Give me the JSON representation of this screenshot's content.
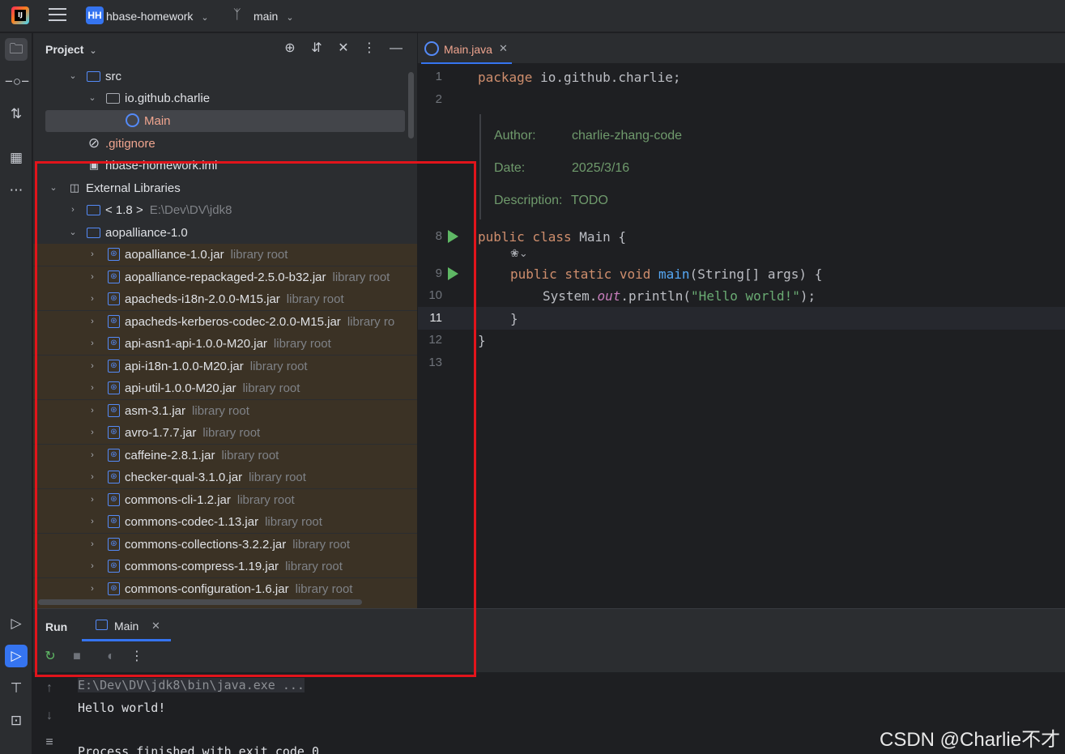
{
  "titlebar": {
    "project_badge": "HH",
    "project_name": "hbase-homework",
    "branch": "main"
  },
  "left_strip": {
    "icons": [
      "folder-icon",
      "commit-icon",
      "pull-requests-icon",
      "structure-icon",
      "more-icon",
      "services-icon",
      "run-icon",
      "build-icon",
      "terminal-icon"
    ]
  },
  "project_panel": {
    "title": "Project",
    "tree": [
      {
        "label": "src",
        "sub": ""
      },
      {
        "label": "io.github.charlie",
        "sub": ""
      },
      {
        "label": "Main",
        "sub": ""
      },
      {
        "label": ".gitignore",
        "sub": ""
      },
      {
        "label": "hbase-homework.iml",
        "sub": ""
      },
      {
        "label": "External Libraries",
        "sub": ""
      },
      {
        "label": "< 1.8 >",
        "sub": "E:\\Dev\\DV\\jdk8"
      },
      {
        "label": "aopalliance-1.0",
        "sub": ""
      },
      {
        "label": "aopalliance-1.0.jar",
        "sub": "library root"
      },
      {
        "label": "aopalliance-repackaged-2.5.0-b32.jar",
        "sub": "library root"
      },
      {
        "label": "apacheds-i18n-2.0.0-M15.jar",
        "sub": "library root"
      },
      {
        "label": "apacheds-kerberos-codec-2.0.0-M15.jar",
        "sub": "library ro"
      },
      {
        "label": "api-asn1-api-1.0.0-M20.jar",
        "sub": "library root"
      },
      {
        "label": "api-i18n-1.0.0-M20.jar",
        "sub": "library root"
      },
      {
        "label": "api-util-1.0.0-M20.jar",
        "sub": "library root"
      },
      {
        "label": "asm-3.1.jar",
        "sub": "library root"
      },
      {
        "label": "avro-1.7.7.jar",
        "sub": "library root"
      },
      {
        "label": "caffeine-2.8.1.jar",
        "sub": "library root"
      },
      {
        "label": "checker-qual-3.1.0.jar",
        "sub": "library root"
      },
      {
        "label": "commons-cli-1.2.jar",
        "sub": "library root"
      },
      {
        "label": "commons-codec-1.13.jar",
        "sub": "library root"
      },
      {
        "label": "commons-collections-3.2.2.jar",
        "sub": "library root"
      },
      {
        "label": "commons-compress-1.19.jar",
        "sub": "library root"
      },
      {
        "label": "commons-configuration-1.6.jar",
        "sub": "library root"
      }
    ]
  },
  "editor": {
    "tab_label": "Main.java",
    "line_numbers": [
      "1",
      "2",
      "8",
      "9",
      "10",
      "11",
      "12",
      "13"
    ],
    "code": {
      "l1_kw": "package",
      "l1_rest": " io.github.charlie;",
      "l8_kw": "public class",
      "l8_rest": " Main {",
      "l9_kw": "public static void",
      "l9_fn": "main",
      "l9_rest": "(String[] args) {",
      "l10_a": "System.",
      "l10_b": "out",
      "l10_c": ".println(",
      "l10_d": "\"Hello world!\"",
      "l10_e": ");",
      "l11": "}",
      "l12": "}"
    },
    "doc": {
      "author_label": "Author:",
      "author_value": "charlie-zhang-code",
      "date_label": "Date:",
      "date_value": "2025/3/16",
      "desc_label": "Description:",
      "desc_value": "TODO"
    }
  },
  "run_panel": {
    "title": "Run",
    "tab_label": "Main",
    "console": [
      "E:\\Dev\\DV\\jdk8\\bin\\java.exe ...",
      "Hello world!",
      "",
      "Process finished with exit code 0"
    ]
  },
  "watermark": "CSDN @Charlie不才",
  "colors": {
    "accent": "#3574f0",
    "highlight_box": "#e2141b",
    "library_row": "#3b3225",
    "keyword": "#cf8e6d",
    "string": "#6aab73"
  }
}
